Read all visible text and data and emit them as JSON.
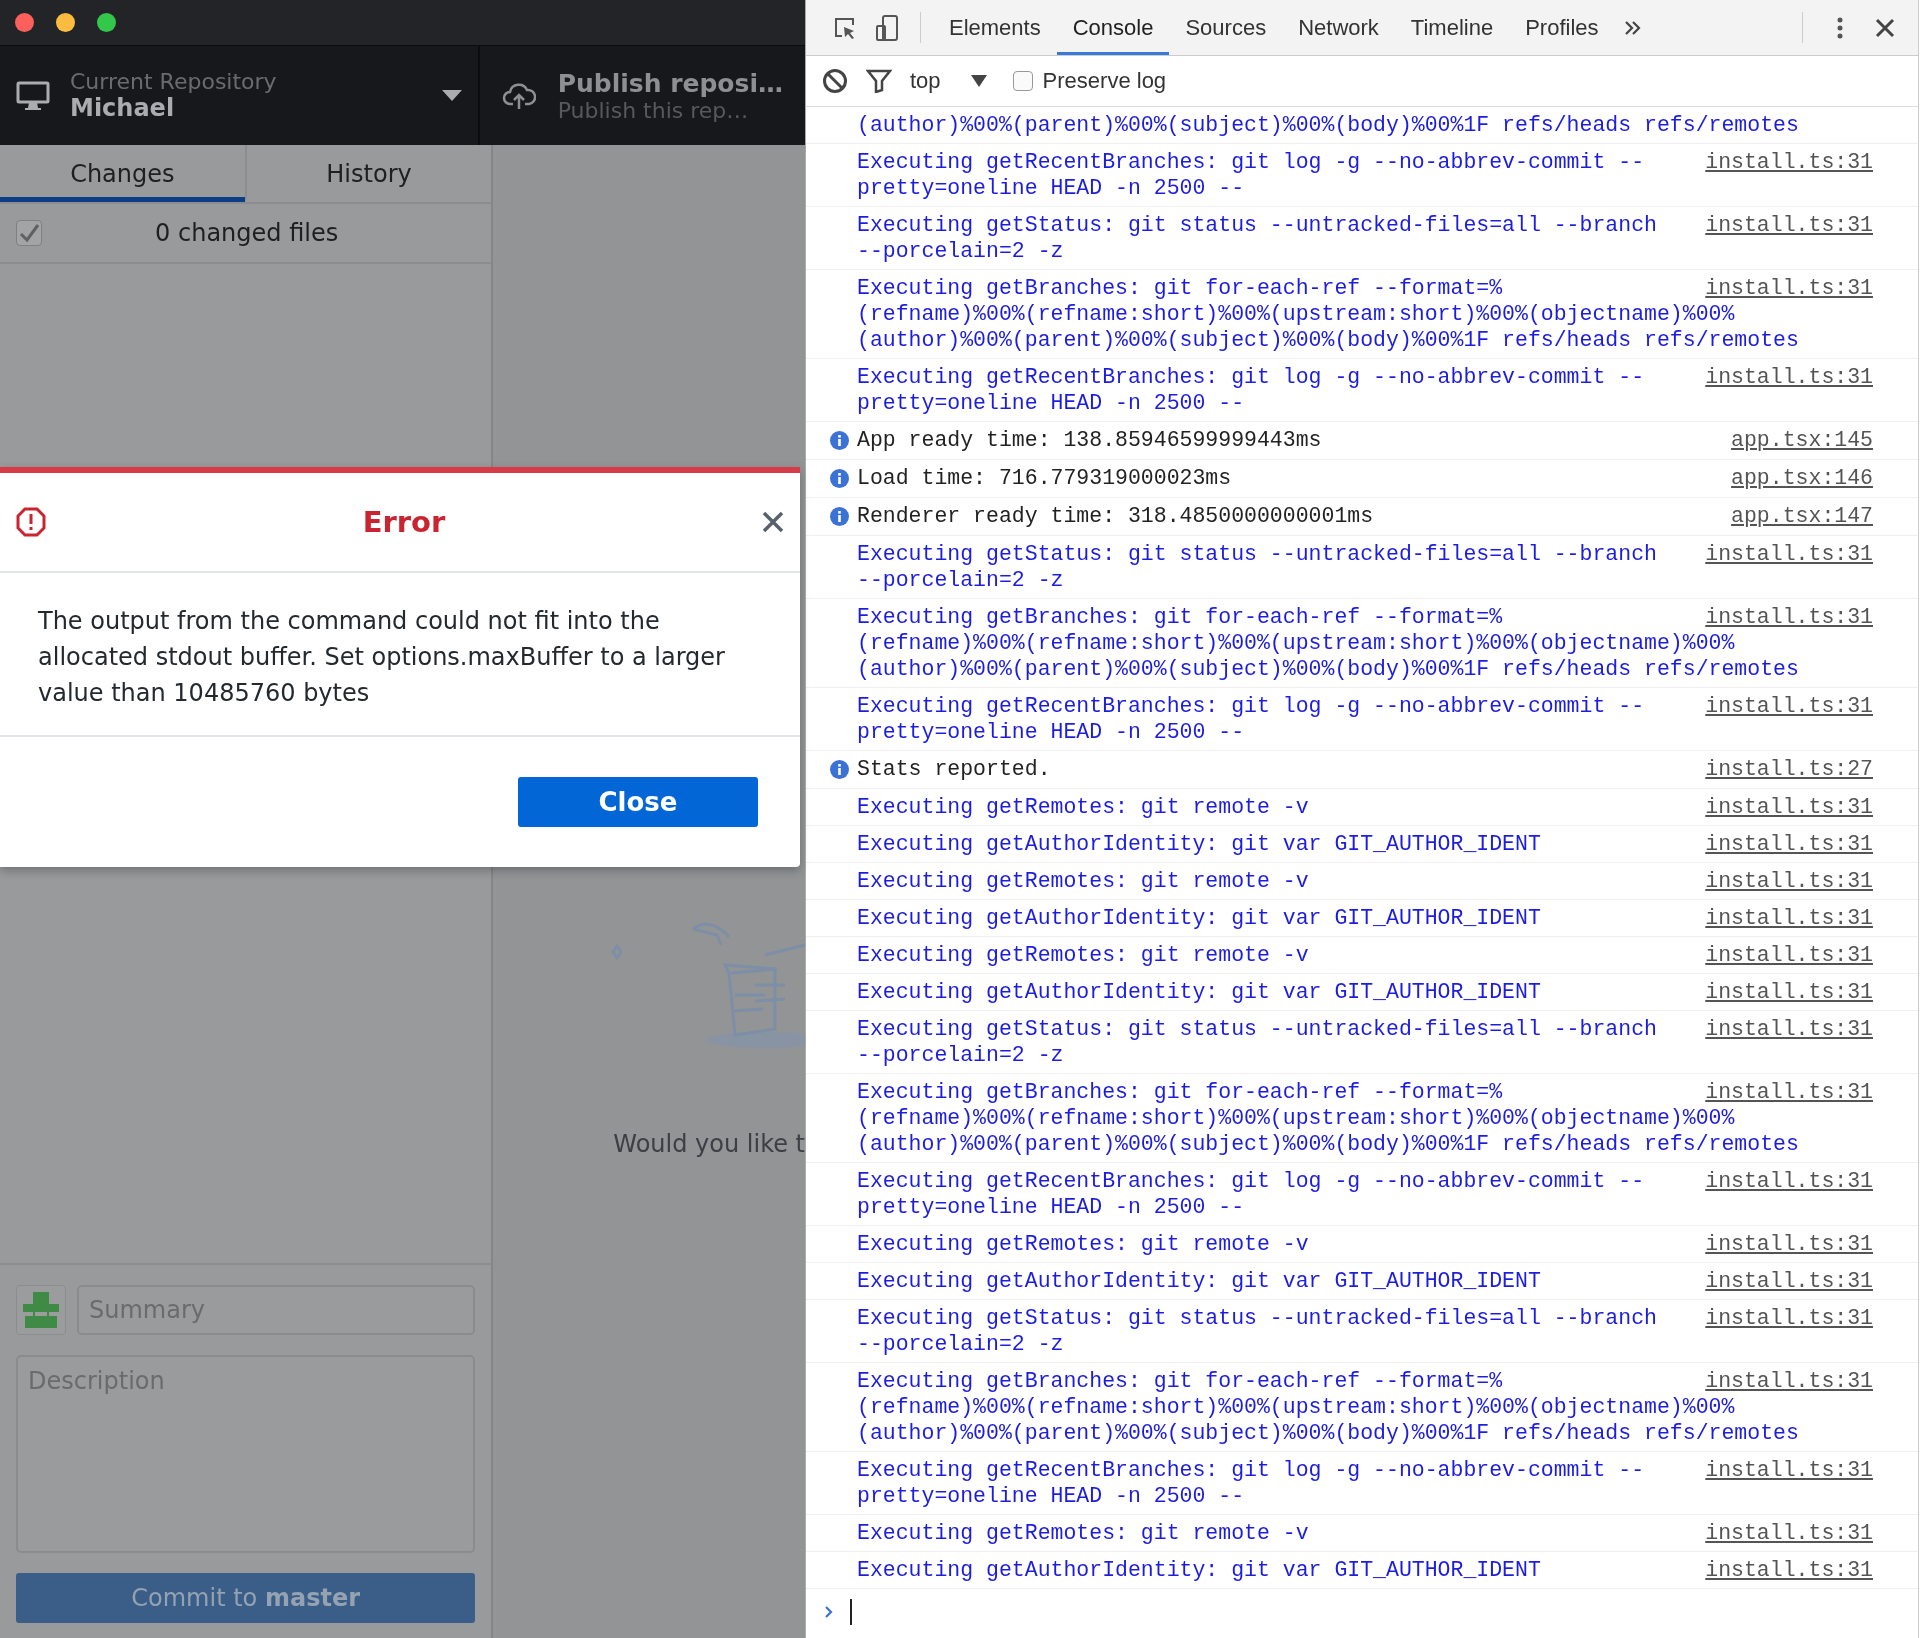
{
  "app": {
    "repository": {
      "label": "Current Repository",
      "name": "Michael"
    },
    "publish": {
      "title": "Publish reposi…",
      "subtitle": "Publish this rep…"
    },
    "tabs": [
      {
        "label": "Changes",
        "selected": true
      },
      {
        "label": "History",
        "selected": false
      }
    ],
    "changes": {
      "checked": true,
      "summary": "0 changed files"
    },
    "commit": {
      "summary_placeholder": "Summary",
      "description_placeholder": "Description",
      "button": "Commit to **master**"
    },
    "blank_slate": {
      "text": "Would you like t"
    }
  },
  "dialog": {
    "title": "Error",
    "message": "The output from the command could not fit into the allocated stdout buffer. Set options.maxBuffer to a larger value than 10485760 bytes",
    "buttons": [
      "Close"
    ]
  },
  "devtools": {
    "tabs": [
      {
        "label": "Elements",
        "selected": false
      },
      {
        "label": "Console",
        "selected": true
      },
      {
        "label": "Sources",
        "selected": false
      },
      {
        "label": "Network",
        "selected": false
      },
      {
        "label": "Timeline",
        "selected": false
      },
      {
        "label": "Profiles",
        "selected": false
      }
    ],
    "context": "top",
    "preserve_log": {
      "label": "Preserve log",
      "checked": false
    },
    "messages": [
      {
        "kind": "log",
        "text": "(author)%00%(parent)%00%(subject)%00%(body)%00%1F refs/heads refs/remotes"
      },
      {
        "kind": "log",
        "text": "Executing getRecentBranches: git log -g --no-abbrev-commit --\npretty=oneline HEAD -n 2500 --",
        "source": "install.ts:31"
      },
      {
        "kind": "log",
        "text": "Executing getStatus: git status --untracked-files=all --branch\n--porcelain=2 -z",
        "source": "install.ts:31"
      },
      {
        "kind": "log",
        "text": "Executing getBranches: git for-each-ref --format=%\n(refname)%00%(refname:short)%00%(upstream:short)%00%(objectname)%00%\n(author)%00%(parent)%00%(subject)%00%(body)%00%1F refs/heads refs/remotes",
        "source": "install.ts:31"
      },
      {
        "kind": "log",
        "text": "Executing getRecentBranches: git log -g --no-abbrev-commit --\npretty=oneline HEAD -n 2500 --",
        "source": "install.ts:31"
      },
      {
        "kind": "info",
        "text": "App ready time: 138.85946599999443ms",
        "source": "app.tsx:145"
      },
      {
        "kind": "info",
        "text": "Load time: 716.779319000023ms",
        "source": "app.tsx:146"
      },
      {
        "kind": "info",
        "text": "Renderer ready time: 318.4850000000001ms",
        "source": "app.tsx:147"
      },
      {
        "kind": "log",
        "text": "Executing getStatus: git status --untracked-files=all --branch\n--porcelain=2 -z",
        "source": "install.ts:31"
      },
      {
        "kind": "log",
        "text": "Executing getBranches: git for-each-ref --format=%\n(refname)%00%(refname:short)%00%(upstream:short)%00%(objectname)%00%\n(author)%00%(parent)%00%(subject)%00%(body)%00%1F refs/heads refs/remotes",
        "source": "install.ts:31"
      },
      {
        "kind": "log",
        "text": "Executing getRecentBranches: git log -g --no-abbrev-commit --\npretty=oneline HEAD -n 2500 --",
        "source": "install.ts:31"
      },
      {
        "kind": "info",
        "text": "Stats reported.",
        "source": "install.ts:27"
      },
      {
        "kind": "log",
        "text": "Executing getRemotes: git remote -v",
        "source": "install.ts:31"
      },
      {
        "kind": "log",
        "text": "Executing getAuthorIdentity: git var GIT_AUTHOR_IDENT",
        "source": "install.ts:31"
      },
      {
        "kind": "log",
        "text": "Executing getRemotes: git remote -v",
        "source": "install.ts:31"
      },
      {
        "kind": "log",
        "text": "Executing getAuthorIdentity: git var GIT_AUTHOR_IDENT",
        "source": "install.ts:31"
      },
      {
        "kind": "log",
        "text": "Executing getRemotes: git remote -v",
        "source": "install.ts:31"
      },
      {
        "kind": "log",
        "text": "Executing getAuthorIdentity: git var GIT_AUTHOR_IDENT",
        "source": "install.ts:31"
      },
      {
        "kind": "log",
        "text": "Executing getStatus: git status --untracked-files=all --branch\n--porcelain=2 -z",
        "source": "install.ts:31"
      },
      {
        "kind": "log",
        "text": "Executing getBranches: git for-each-ref --format=%\n(refname)%00%(refname:short)%00%(upstream:short)%00%(objectname)%00%\n(author)%00%(parent)%00%(subject)%00%(body)%00%1F refs/heads refs/remotes",
        "source": "install.ts:31"
      },
      {
        "kind": "log",
        "text": "Executing getRecentBranches: git log -g --no-abbrev-commit --\npretty=oneline HEAD -n 2500 --",
        "source": "install.ts:31"
      },
      {
        "kind": "log",
        "text": "Executing getRemotes: git remote -v",
        "source": "install.ts:31"
      },
      {
        "kind": "log",
        "text": "Executing getAuthorIdentity: git var GIT_AUTHOR_IDENT",
        "source": "install.ts:31"
      },
      {
        "kind": "log",
        "text": "Executing getStatus: git status --untracked-files=all --branch\n--porcelain=2 -z",
        "source": "install.ts:31"
      },
      {
        "kind": "log",
        "text": "Executing getBranches: git for-each-ref --format=%\n(refname)%00%(refname:short)%00%(upstream:short)%00%(objectname)%00%\n(author)%00%(parent)%00%(subject)%00%(body)%00%1F refs/heads refs/remotes",
        "source": "install.ts:31"
      },
      {
        "kind": "log",
        "text": "Executing getRecentBranches: git log -g --no-abbrev-commit --\npretty=oneline HEAD -n 2500 --",
        "source": "install.ts:31"
      },
      {
        "kind": "log",
        "text": "Executing getRemotes: git remote -v",
        "source": "install.ts:31"
      },
      {
        "kind": "log",
        "text": "Executing getAuthorIdentity: git var GIT_AUTHOR_IDENT",
        "source": "install.ts:31"
      }
    ]
  }
}
